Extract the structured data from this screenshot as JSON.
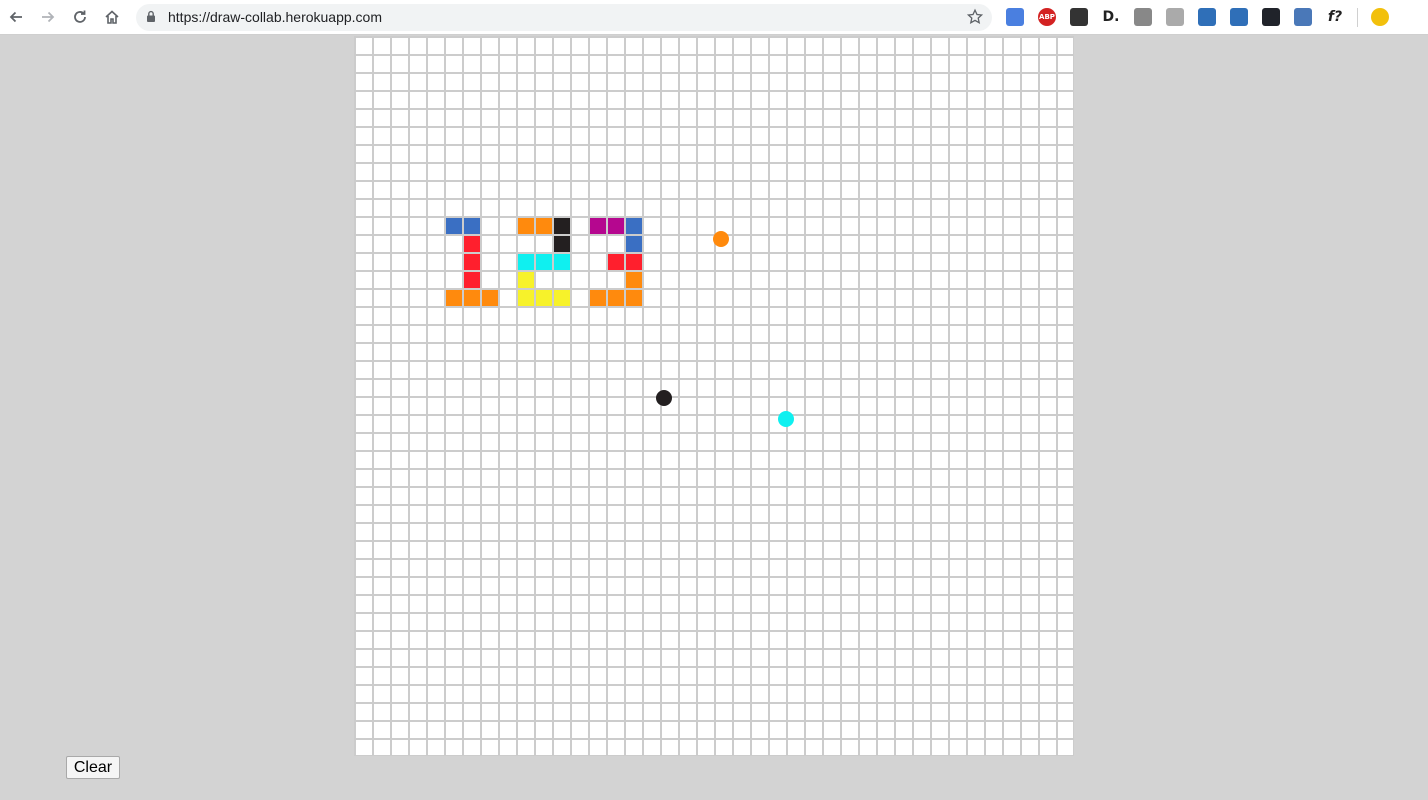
{
  "browser": {
    "url": "https://draw-collab.herokuapp.com",
    "extensions": [
      {
        "icon": "translate-icon",
        "label": "",
        "color": "#4a7fe0"
      },
      {
        "icon": "adblock-plus-icon",
        "label": "ABP",
        "color": "#d32222"
      },
      {
        "icon": "spy-hat-icon",
        "label": "",
        "color": "#333333"
      },
      {
        "icon": "d-logo-icon",
        "label": "D.",
        "color": "#222222"
      },
      {
        "icon": "layout-icon",
        "label": "",
        "color": "#888888"
      },
      {
        "icon": "keyboard-icon",
        "label": "",
        "color": "#aaaaaa"
      },
      {
        "icon": "magnifier-icon",
        "label": "",
        "color": "#2f6fb8"
      },
      {
        "icon": "copy-window-icon",
        "label": "",
        "color": "#2f6fb8"
      },
      {
        "icon": "react-icon",
        "label": "",
        "color": "#20232a"
      },
      {
        "icon": "panel-icon",
        "label": "",
        "color": "#4a78b8"
      },
      {
        "icon": "font-identifier-icon",
        "label": "f?",
        "color": "#222222"
      },
      {
        "icon": "lightbulb-icon",
        "label": "",
        "color": "#f2c00c"
      }
    ]
  },
  "canvas": {
    "cols": 40,
    "rows": 40,
    "cell_color": "#ffffff",
    "grid_line_color": "#cccccc",
    "painted_cells": [
      {
        "col": 5,
        "row": 10,
        "color": "#3a6fc3"
      },
      {
        "col": 6,
        "row": 10,
        "color": "#3a6fc3"
      },
      {
        "col": 6,
        "row": 11,
        "color": "#ff1f2d"
      },
      {
        "col": 6,
        "row": 12,
        "color": "#ff1f2d"
      },
      {
        "col": 6,
        "row": 13,
        "color": "#ff1f2d"
      },
      {
        "col": 5,
        "row": 14,
        "color": "#ff8a0d"
      },
      {
        "col": 6,
        "row": 14,
        "color": "#ff8a0d"
      },
      {
        "col": 7,
        "row": 14,
        "color": "#ff8a0d"
      },
      {
        "col": 9,
        "row": 10,
        "color": "#ff8a0d"
      },
      {
        "col": 10,
        "row": 10,
        "color": "#ff8a0d"
      },
      {
        "col": 11,
        "row": 10,
        "color": "#231f20"
      },
      {
        "col": 11,
        "row": 11,
        "color": "#231f20"
      },
      {
        "col": 9,
        "row": 12,
        "color": "#0ff0f0"
      },
      {
        "col": 10,
        "row": 12,
        "color": "#0ff0f0"
      },
      {
        "col": 11,
        "row": 12,
        "color": "#0ff0f0"
      },
      {
        "col": 9,
        "row": 13,
        "color": "#f7f22a"
      },
      {
        "col": 9,
        "row": 14,
        "color": "#f7f22a"
      },
      {
        "col": 10,
        "row": 14,
        "color": "#f7f22a"
      },
      {
        "col": 11,
        "row": 14,
        "color": "#f7f22a"
      },
      {
        "col": 13,
        "row": 10,
        "color": "#b5078f"
      },
      {
        "col": 14,
        "row": 10,
        "color": "#b5078f"
      },
      {
        "col": 15,
        "row": 10,
        "color": "#3a6fc3"
      },
      {
        "col": 15,
        "row": 11,
        "color": "#3a6fc3"
      },
      {
        "col": 14,
        "row": 12,
        "color": "#ff1f2d"
      },
      {
        "col": 15,
        "row": 12,
        "color": "#ff1f2d"
      },
      {
        "col": 15,
        "row": 13,
        "color": "#ff8a0d"
      },
      {
        "col": 13,
        "row": 14,
        "color": "#ff8a0d"
      },
      {
        "col": 14,
        "row": 14,
        "color": "#ff8a0d"
      },
      {
        "col": 15,
        "row": 14,
        "color": "#ff8a0d"
      }
    ],
    "cursors": [
      {
        "col": 20.4,
        "row": 11.3,
        "color": "#ff8a0d"
      },
      {
        "col": 17.2,
        "row": 20.1,
        "color": "#231f20"
      },
      {
        "col": 24.0,
        "row": 21.3,
        "color": "#0ff0f0"
      }
    ]
  },
  "controls": {
    "clear_label": "Clear"
  }
}
